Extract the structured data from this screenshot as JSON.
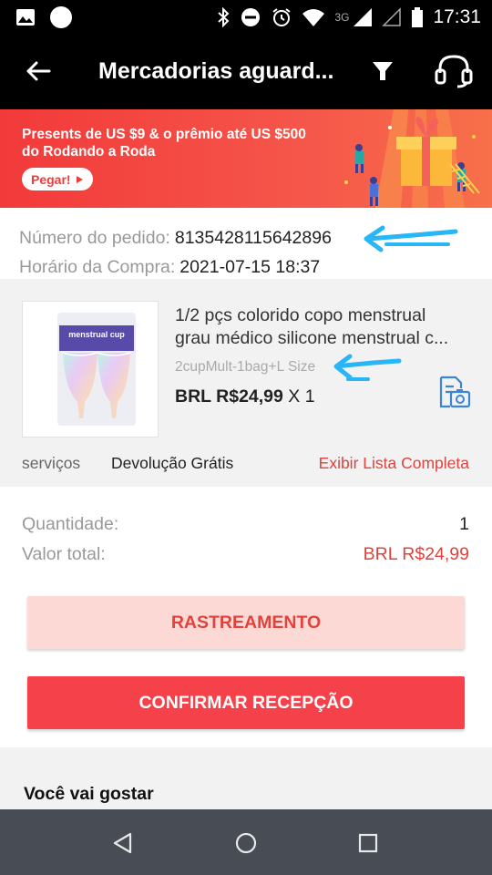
{
  "status_bar": {
    "time": "17:31",
    "network": "3G",
    "icons": [
      "gallery-icon",
      "circle-icon",
      "bluetooth-icon",
      "do-not-disturb-icon",
      "alarm-icon",
      "wifi-icon",
      "signal-icon",
      "signal-empty-icon",
      "battery-icon"
    ]
  },
  "header": {
    "title": "Mercadorias aguard...",
    "icons": [
      "back-arrow-icon",
      "filter-icon",
      "headset-icon"
    ]
  },
  "banner": {
    "text": "Presents de  US $9 & o prêmio até US $500 do Rodando a Roda",
    "button": "Pegar!"
  },
  "order": {
    "number_label": "Número do pedido:",
    "number_value": "8135428115642896",
    "time_label": "Horário da Compra:",
    "time_value": "2021-07-15 18:37"
  },
  "product": {
    "image_label": "menstrual cup",
    "title_line1": "1/2 pçs colorido copo menstrual",
    "title_line2": "grau médico silicone menstrual c...",
    "sku": "2cupMult-1bag+L Size",
    "price": "BRL R$24,99",
    "quantity": " X 1",
    "services_label": "serviços",
    "services_value": "Devolução Grátis",
    "services_link": "Exibir Lista Completa"
  },
  "totals": {
    "quantity_label": "Quantidade:",
    "quantity_value": "1",
    "total_label": "Valor total:",
    "total_value": "BRL R$24,99"
  },
  "buttons": {
    "tracking": "RASTREAMENTO",
    "confirm": "CONFIRMAR RECEPÇÃO"
  },
  "suggestions": {
    "title": "Você vai gostar"
  },
  "colors": {
    "accent_red": "#e0423c",
    "confirm_red": "#f5424a",
    "annotation_blue": "#29b6f6",
    "nav_bar": "#484c55"
  }
}
